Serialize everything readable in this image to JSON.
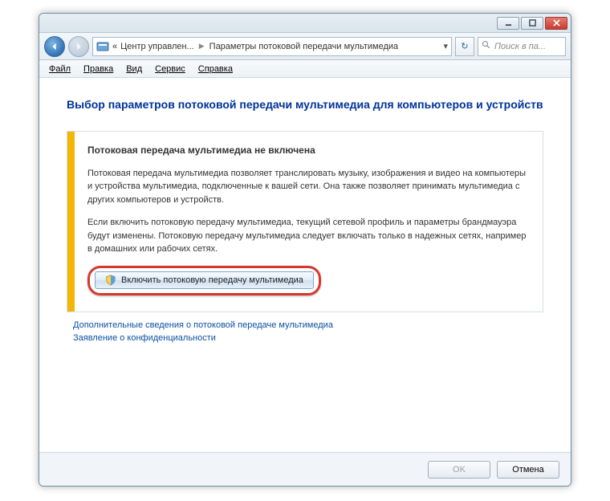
{
  "titlebar": {
    "minimize_icon": "minimize",
    "maximize_icon": "maximize",
    "close_icon": "close"
  },
  "navbar": {
    "back_icon": "arrow-left",
    "forward_icon": "arrow-right",
    "address_marker": "«",
    "breadcrumb1": "Центр управлен...",
    "breadcrumb2": "Параметры потоковой передачи мультимедиа",
    "dropdown_arrow": "▾",
    "refresh_icon": "↻",
    "search_placeholder": "Поиск в па...",
    "search_icon": "search"
  },
  "menubar": {
    "items": [
      {
        "label": "Файл"
      },
      {
        "label": "Правка"
      },
      {
        "label": "Вид"
      },
      {
        "label": "Сервис"
      },
      {
        "label": "Справка"
      }
    ]
  },
  "content": {
    "heading": "Выбор параметров потоковой передачи мультимедиа для компьютеров и устройств",
    "panel": {
      "title": "Потоковая передача мультимедиа не включена",
      "p1": "Потоковая передача мультимедиа позволяет транслировать музыку, изображения и видео на компьютеры и устройства мультимедиа, подключенные к вашей сети. Она также позволяет принимать мультимедиа с других компьютеров и устройств.",
      "p2": "Если включить потоковую передачу мультимедиа, текущий сетевой профиль и параметры брандмауэра будут изменены. Потоковую передачу мультимедиа следует включать только в надежных сетях, например в домашних или рабочих сетях.",
      "action_label": "Включить потоковую передачу мультимедиа"
    },
    "links": {
      "more_info": "Дополнительные сведения о потоковой передаче мультимедиа",
      "privacy": "Заявление о конфиденциальности"
    }
  },
  "footer": {
    "ok_label": "OK",
    "cancel_label": "Отмена"
  }
}
